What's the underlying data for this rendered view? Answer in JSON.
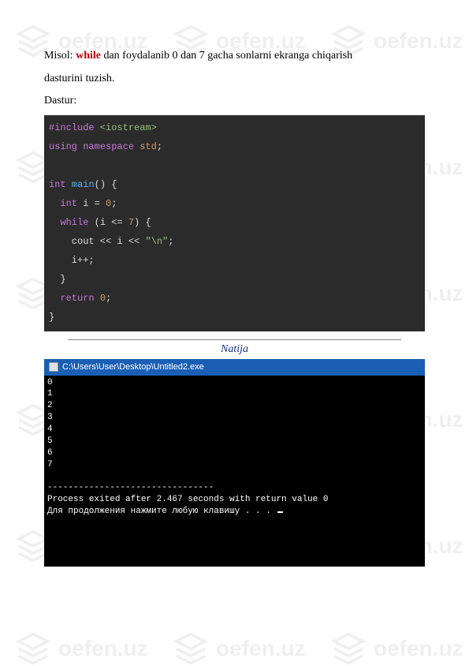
{
  "intro": {
    "prefix": "Misol: ",
    "keyword": "while",
    "rest": " dan foydalanib 0 dan 7 gacha sonlarni ekranga chiqarish",
    "line2": "dasturini tuzish.",
    "dastur": "Dastur:"
  },
  "code": {
    "l1_pre": "#include",
    "l1_inc": " <iostream>",
    "l2_kw1": "using",
    "l2_kw2": " namespace",
    "l2_ns": " std",
    "l2_end": ";",
    "l3_kw": "int",
    "l3_fn": " main",
    "l3_rest": "() {",
    "l4_pre": "  ",
    "l4_kw": "int",
    "l4_mid": " i = ",
    "l4_num": "0",
    "l4_end": ";",
    "l5_pre": "  ",
    "l5_kw": "while",
    "l5_mid": " (i <= ",
    "l5_num": "7",
    "l5_end": ") {",
    "l6": "    cout << i << ",
    "l6_str": "\"\\n\"",
    "l6_end": ";",
    "l7": "    i++;",
    "l8": "  }",
    "l9_pre": "  ",
    "l9_kw": "return",
    "l9_sp": " ",
    "l9_num": "0",
    "l9_end": ";",
    "l10": "}"
  },
  "result_label": "Natija",
  "console": {
    "title": "C:\\Users\\User\\Desktop\\Untitled2.exe",
    "lines": [
      "0",
      "1",
      "2",
      "3",
      "4",
      "5",
      "6",
      "7"
    ],
    "sep": "--------------------------------",
    "proc": "Process exited after 2.467 seconds with return value 0",
    "press": "Для продолжения нажмите любую клавишу . . . "
  },
  "watermark_text": "oefen.uz"
}
